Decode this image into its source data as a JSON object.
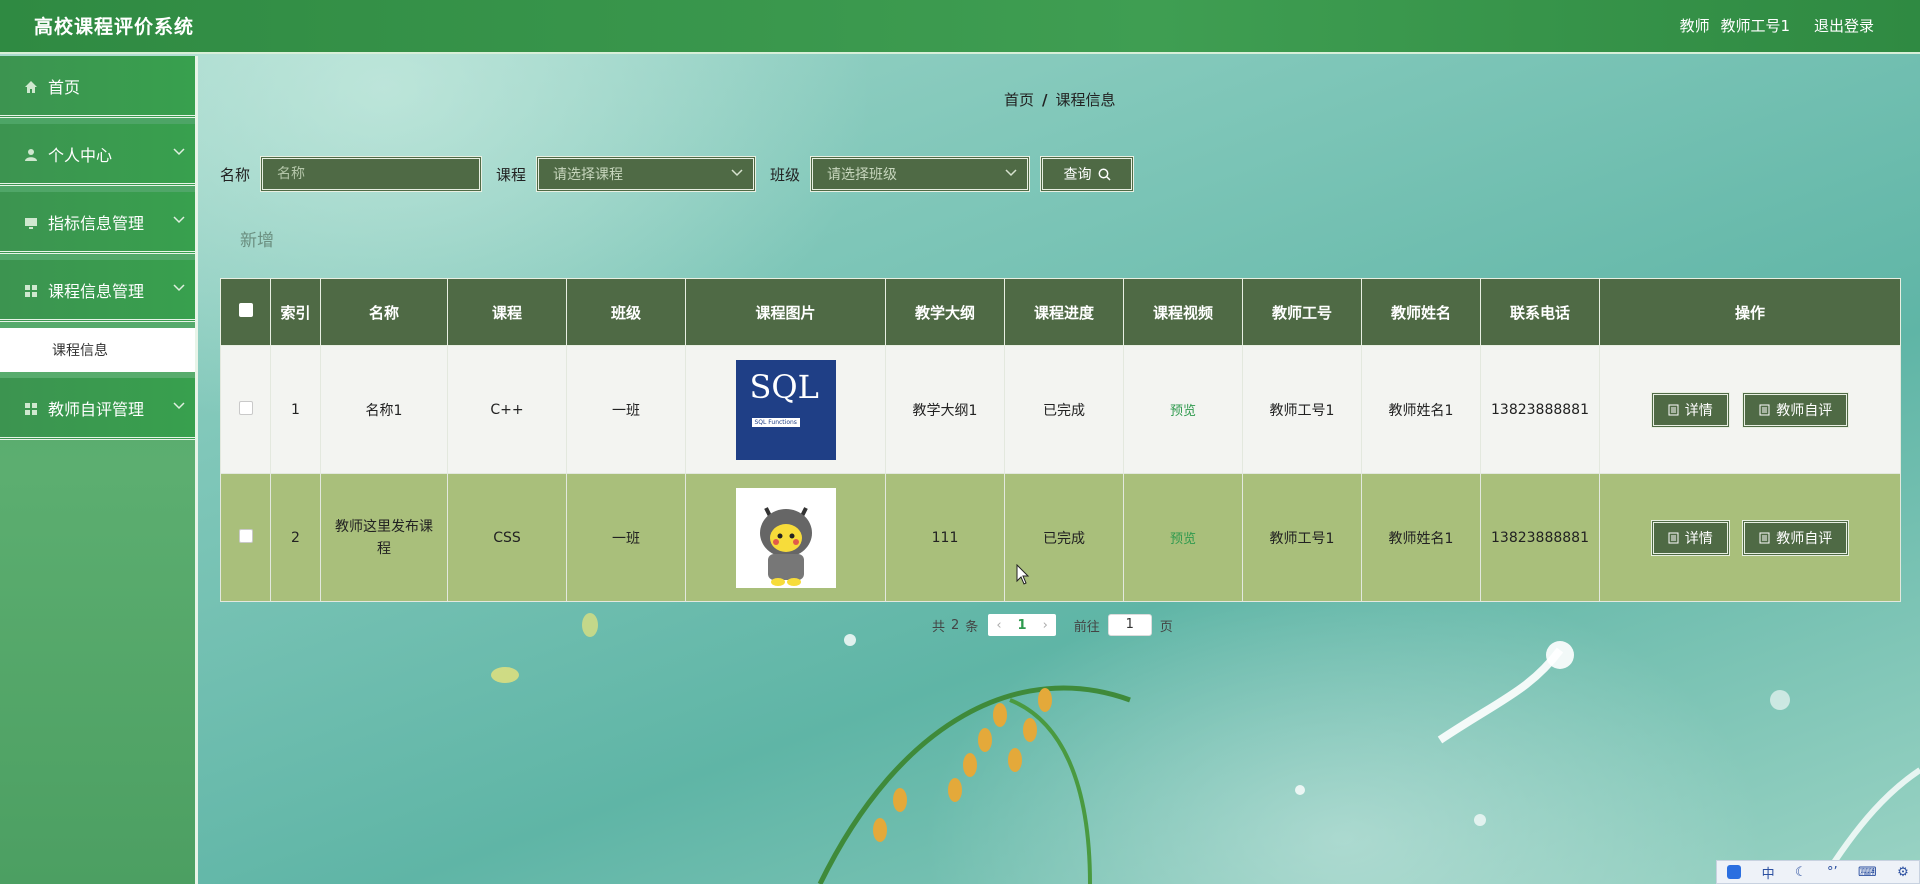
{
  "header": {
    "title": "高校课程评价系统",
    "user_role": "教师",
    "user_name": "教师工号1",
    "logout": "退出登录"
  },
  "sidebar": {
    "items": [
      {
        "label": "首页",
        "icon": "home-icon"
      },
      {
        "label": "个人中心",
        "icon": "user-icon"
      },
      {
        "label": "指标信息管理",
        "icon": "monitor-icon"
      },
      {
        "label": "课程信息管理",
        "icon": "grid-icon"
      },
      {
        "label": "教师自评管理",
        "icon": "grid-icon"
      }
    ],
    "submenu": {
      "label": "课程信息"
    }
  },
  "breadcrumb": {
    "home": "首页",
    "sep": "/",
    "current": "课程信息"
  },
  "search": {
    "name_label": "名称",
    "name_placeholder": "名称",
    "course_label": "课程",
    "course_placeholder": "请选择课程",
    "class_label": "班级",
    "class_placeholder": "请选择班级",
    "query_label": "查询"
  },
  "add_label": "新增",
  "table": {
    "headers": [
      "索引",
      "名称",
      "课程",
      "班级",
      "课程图片",
      "教学大纲",
      "课程进度",
      "课程视频",
      "教师工号",
      "教师姓名",
      "联系电话",
      "操作"
    ],
    "rows": [
      {
        "index": "1",
        "name": "名称1",
        "course": "C++",
        "class": "一班",
        "image": "sql-book-cover",
        "image_title": "SQL",
        "image_sub": "SQL Functions",
        "syllabus": "教学大纲1",
        "progress": "已完成",
        "video": "预览",
        "teacher_id": "教师工号1",
        "teacher_name": "教师姓名1",
        "phone": "13823888881",
        "detail": "详情",
        "self_eval": "教师自评"
      },
      {
        "index": "2",
        "name": "教师这里发布课程",
        "course": "CSS",
        "class": "一班",
        "image": "hooded-pikachu-figure",
        "syllabus": "111",
        "progress": "已完成",
        "video": "预览",
        "teacher_id": "教师工号1",
        "teacher_name": "教师姓名1",
        "phone": "13823888881",
        "detail": "详情",
        "self_eval": "教师自评"
      }
    ]
  },
  "pagination": {
    "total_prefix": "共",
    "total": "2",
    "total_suffix": "条",
    "current": "1",
    "goto_prefix": "前往",
    "goto_value": "1",
    "goto_suffix": "页"
  },
  "ime": {
    "mode": "中"
  },
  "colors": {
    "header": "#3a9a4d",
    "accent": "#4f6a45",
    "row_alt": "#a9bf7b",
    "link": "#2f9a4e"
  }
}
